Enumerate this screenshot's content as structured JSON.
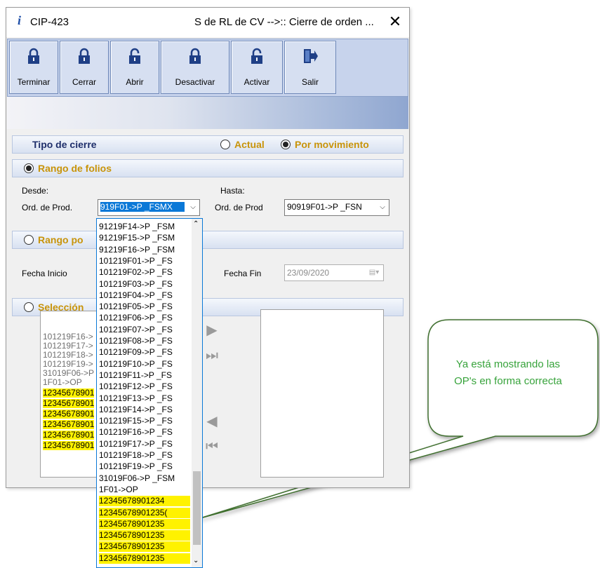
{
  "window": {
    "icon": "info-icon",
    "code": "CIP-423",
    "title": "S de RL de CV -->:: Cierre de orden ...",
    "close": "✕"
  },
  "toolbar": {
    "buttons": [
      {
        "label": "Terminar",
        "icon": "lock-closed-icon"
      },
      {
        "label": "Cerrar",
        "icon": "lock-closed-icon"
      },
      {
        "label": "Abrir",
        "icon": "lock-open-icon"
      },
      {
        "label": "Desactivar",
        "icon": "lock-closed-icon"
      },
      {
        "label": "Activar",
        "icon": "lock-open-icon"
      },
      {
        "label": "Salir",
        "icon": "exit-icon"
      }
    ]
  },
  "tipo_cierre": {
    "title": "Tipo de cierre",
    "option_actual": "Actual",
    "option_movimiento": "Por movimiento",
    "selected": "Por movimiento"
  },
  "rango_folios": {
    "title": "Rango de folios",
    "desde_label": "Desde:",
    "orden_label_1": "Ord. de Prod.",
    "desde_value": "919F01->P _FSMX",
    "hasta_label": "Hasta:",
    "orden_label_2": "Ord. de Prod",
    "hasta_value": "90919F01->P _FSN"
  },
  "rango_fechas": {
    "title": "Rango po",
    "fecha_inicio_label": "Fecha Inicio",
    "fecha_fin_label": "Fecha Fin",
    "fecha_fin_value": "23/09/2020"
  },
  "seleccion": {
    "title": "Selección",
    "left_list": [
      {
        "text": "101219F16->",
        "hl": false
      },
      {
        "text": "101219F17->",
        "hl": false
      },
      {
        "text": "101219F18->",
        "hl": false
      },
      {
        "text": "101219F19->",
        "hl": false
      },
      {
        "text": "31019F06->P",
        "hl": false
      },
      {
        "text": "1F01->OP",
        "hl": false
      },
      {
        "text": "12345678901",
        "hl": true
      },
      {
        "text": "12345678901",
        "hl": true
      },
      {
        "text": "12345678901",
        "hl": true
      },
      {
        "text": "12345678901",
        "hl": true
      },
      {
        "text": "12345678901",
        "hl": true
      },
      {
        "text": "12345678901",
        "hl": true
      }
    ]
  },
  "dropdown": {
    "items": [
      {
        "text": "91219F14->P _FSM",
        "hl": false
      },
      {
        "text": "91219F15->P _FSM",
        "hl": false
      },
      {
        "text": "91219F16->P _FSM",
        "hl": false
      },
      {
        "text": "101219F01->P _FS",
        "hl": false
      },
      {
        "text": "101219F02->P _FS",
        "hl": false
      },
      {
        "text": "101219F03->P _FS",
        "hl": false
      },
      {
        "text": "101219F04->P _FS",
        "hl": false
      },
      {
        "text": "101219F05->P _FS",
        "hl": false
      },
      {
        "text": "101219F06->P _FS",
        "hl": false
      },
      {
        "text": "101219F07->P _FS",
        "hl": false
      },
      {
        "text": "101219F08->P _FS",
        "hl": false
      },
      {
        "text": "101219F09->P _FS",
        "hl": false
      },
      {
        "text": "101219F10->P _FS",
        "hl": false
      },
      {
        "text": "101219F11->P _FS",
        "hl": false
      },
      {
        "text": "101219F12->P _FS",
        "hl": false
      },
      {
        "text": "101219F13->P _FS",
        "hl": false
      },
      {
        "text": "101219F14->P _FS",
        "hl": false
      },
      {
        "text": "101219F15->P _FS",
        "hl": false
      },
      {
        "text": "101219F16->P _FS",
        "hl": false
      },
      {
        "text": "101219F17->P _FS",
        "hl": false
      },
      {
        "text": "101219F18->P _FS",
        "hl": false
      },
      {
        "text": "101219F19->P _FS",
        "hl": false
      },
      {
        "text": "31019F06->P _FSM",
        "hl": false
      },
      {
        "text": "1F01->OP",
        "hl": false
      },
      {
        "text": "12345678901234",
        "hl": true
      },
      {
        "text": "12345678901235(",
        "hl": true
      },
      {
        "text": "12345678901235",
        "hl": true
      },
      {
        "text": "12345678901235",
        "hl": true
      },
      {
        "text": "12345678901235",
        "hl": true
      },
      {
        "text": "12345678901235",
        "hl": true
      }
    ]
  },
  "callout": {
    "line1": "Ya está mostrando las",
    "line2": "OP's en forma correcta",
    "color": "#37a33b"
  },
  "colors": {
    "highlight": "#fff200",
    "group_title": "#c8940a",
    "header_title": "#1f2f6b"
  }
}
